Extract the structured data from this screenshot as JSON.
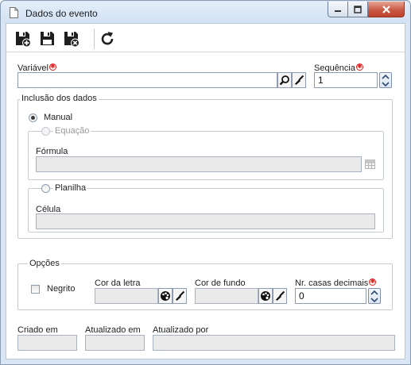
{
  "window": {
    "title": "Dados do evento",
    "accent": "#c0412c"
  },
  "toolbar": {
    "buttons": [
      "save-new-icon",
      "save-icon",
      "save-close-icon",
      "refresh-icon"
    ]
  },
  "form": {
    "variavel_label": "Variável",
    "variavel_value": "",
    "sequencia_label": "Sequência",
    "sequencia_value": "1"
  },
  "inclusao": {
    "legend": "Inclusão dos dados",
    "manual_label": "Manual",
    "manual_selected": true,
    "equacao_label": "Equação",
    "formula_label": "Fórmula",
    "formula_value": "",
    "planilha_label": "Planilha",
    "celula_label": "Célula",
    "celula_value": ""
  },
  "opcoes": {
    "legend": "Opções",
    "negrito_label": "Negrito",
    "negrito_checked": false,
    "cor_letra_label": "Cor da letra",
    "cor_fundo_label": "Cor de fundo",
    "casas_label": "Nr. casas decimais",
    "casas_value": "0"
  },
  "footer": {
    "criado_label": "Criado em",
    "atualizado_label": "Atualizado em",
    "atualizado_por_label": "Atualizado por"
  }
}
